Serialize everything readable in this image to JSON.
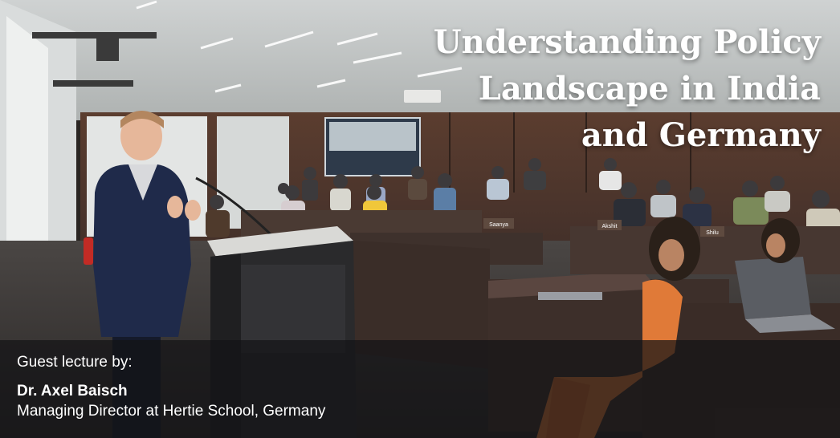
{
  "title": {
    "line1": "Understanding Policy",
    "line2": "Landscape in India",
    "line3": "and Germany"
  },
  "caption": {
    "intro": "Guest lecture by:",
    "speaker_name": "Dr. Axel Baisch",
    "speaker_role": "Managing Director at Hertie School, Germany"
  },
  "name_plates": [
    "Saanya",
    "Akshit",
    "Shilu"
  ],
  "colors": {
    "title_text": "#ffffff",
    "caption_band": "#141416",
    "caption_text": "#ffffff"
  }
}
